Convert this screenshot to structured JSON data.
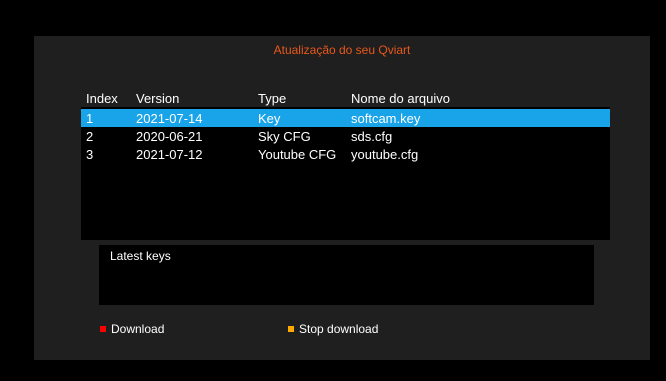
{
  "title": "Atualização do seu Qviart",
  "colors": {
    "title": "#e8581a",
    "selection": "#19a3e8",
    "panel": "#1f1f1f",
    "download_key": "#ff0000",
    "stop_key": "#ffaa00"
  },
  "table": {
    "headers": {
      "index": "Index",
      "version": "Version",
      "type": "Type",
      "name": "Nome do arquivo"
    },
    "rows": [
      {
        "index": "1",
        "version": "2021-07-14",
        "type": "Key",
        "name": "softcam.key",
        "selected": true
      },
      {
        "index": "2",
        "version": "2020-06-21",
        "type": "Sky CFG",
        "name": "sds.cfg",
        "selected": false
      },
      {
        "index": "3",
        "version": "2021-07-12",
        "type": "Youtube CFG",
        "name": "youtube.cfg",
        "selected": false
      }
    ]
  },
  "info": {
    "text": "Latest keys"
  },
  "footer": {
    "download_label": "Download",
    "download_icon": "red-key-icon",
    "stop_label": "Stop download",
    "stop_icon": "yellow-key-icon"
  }
}
